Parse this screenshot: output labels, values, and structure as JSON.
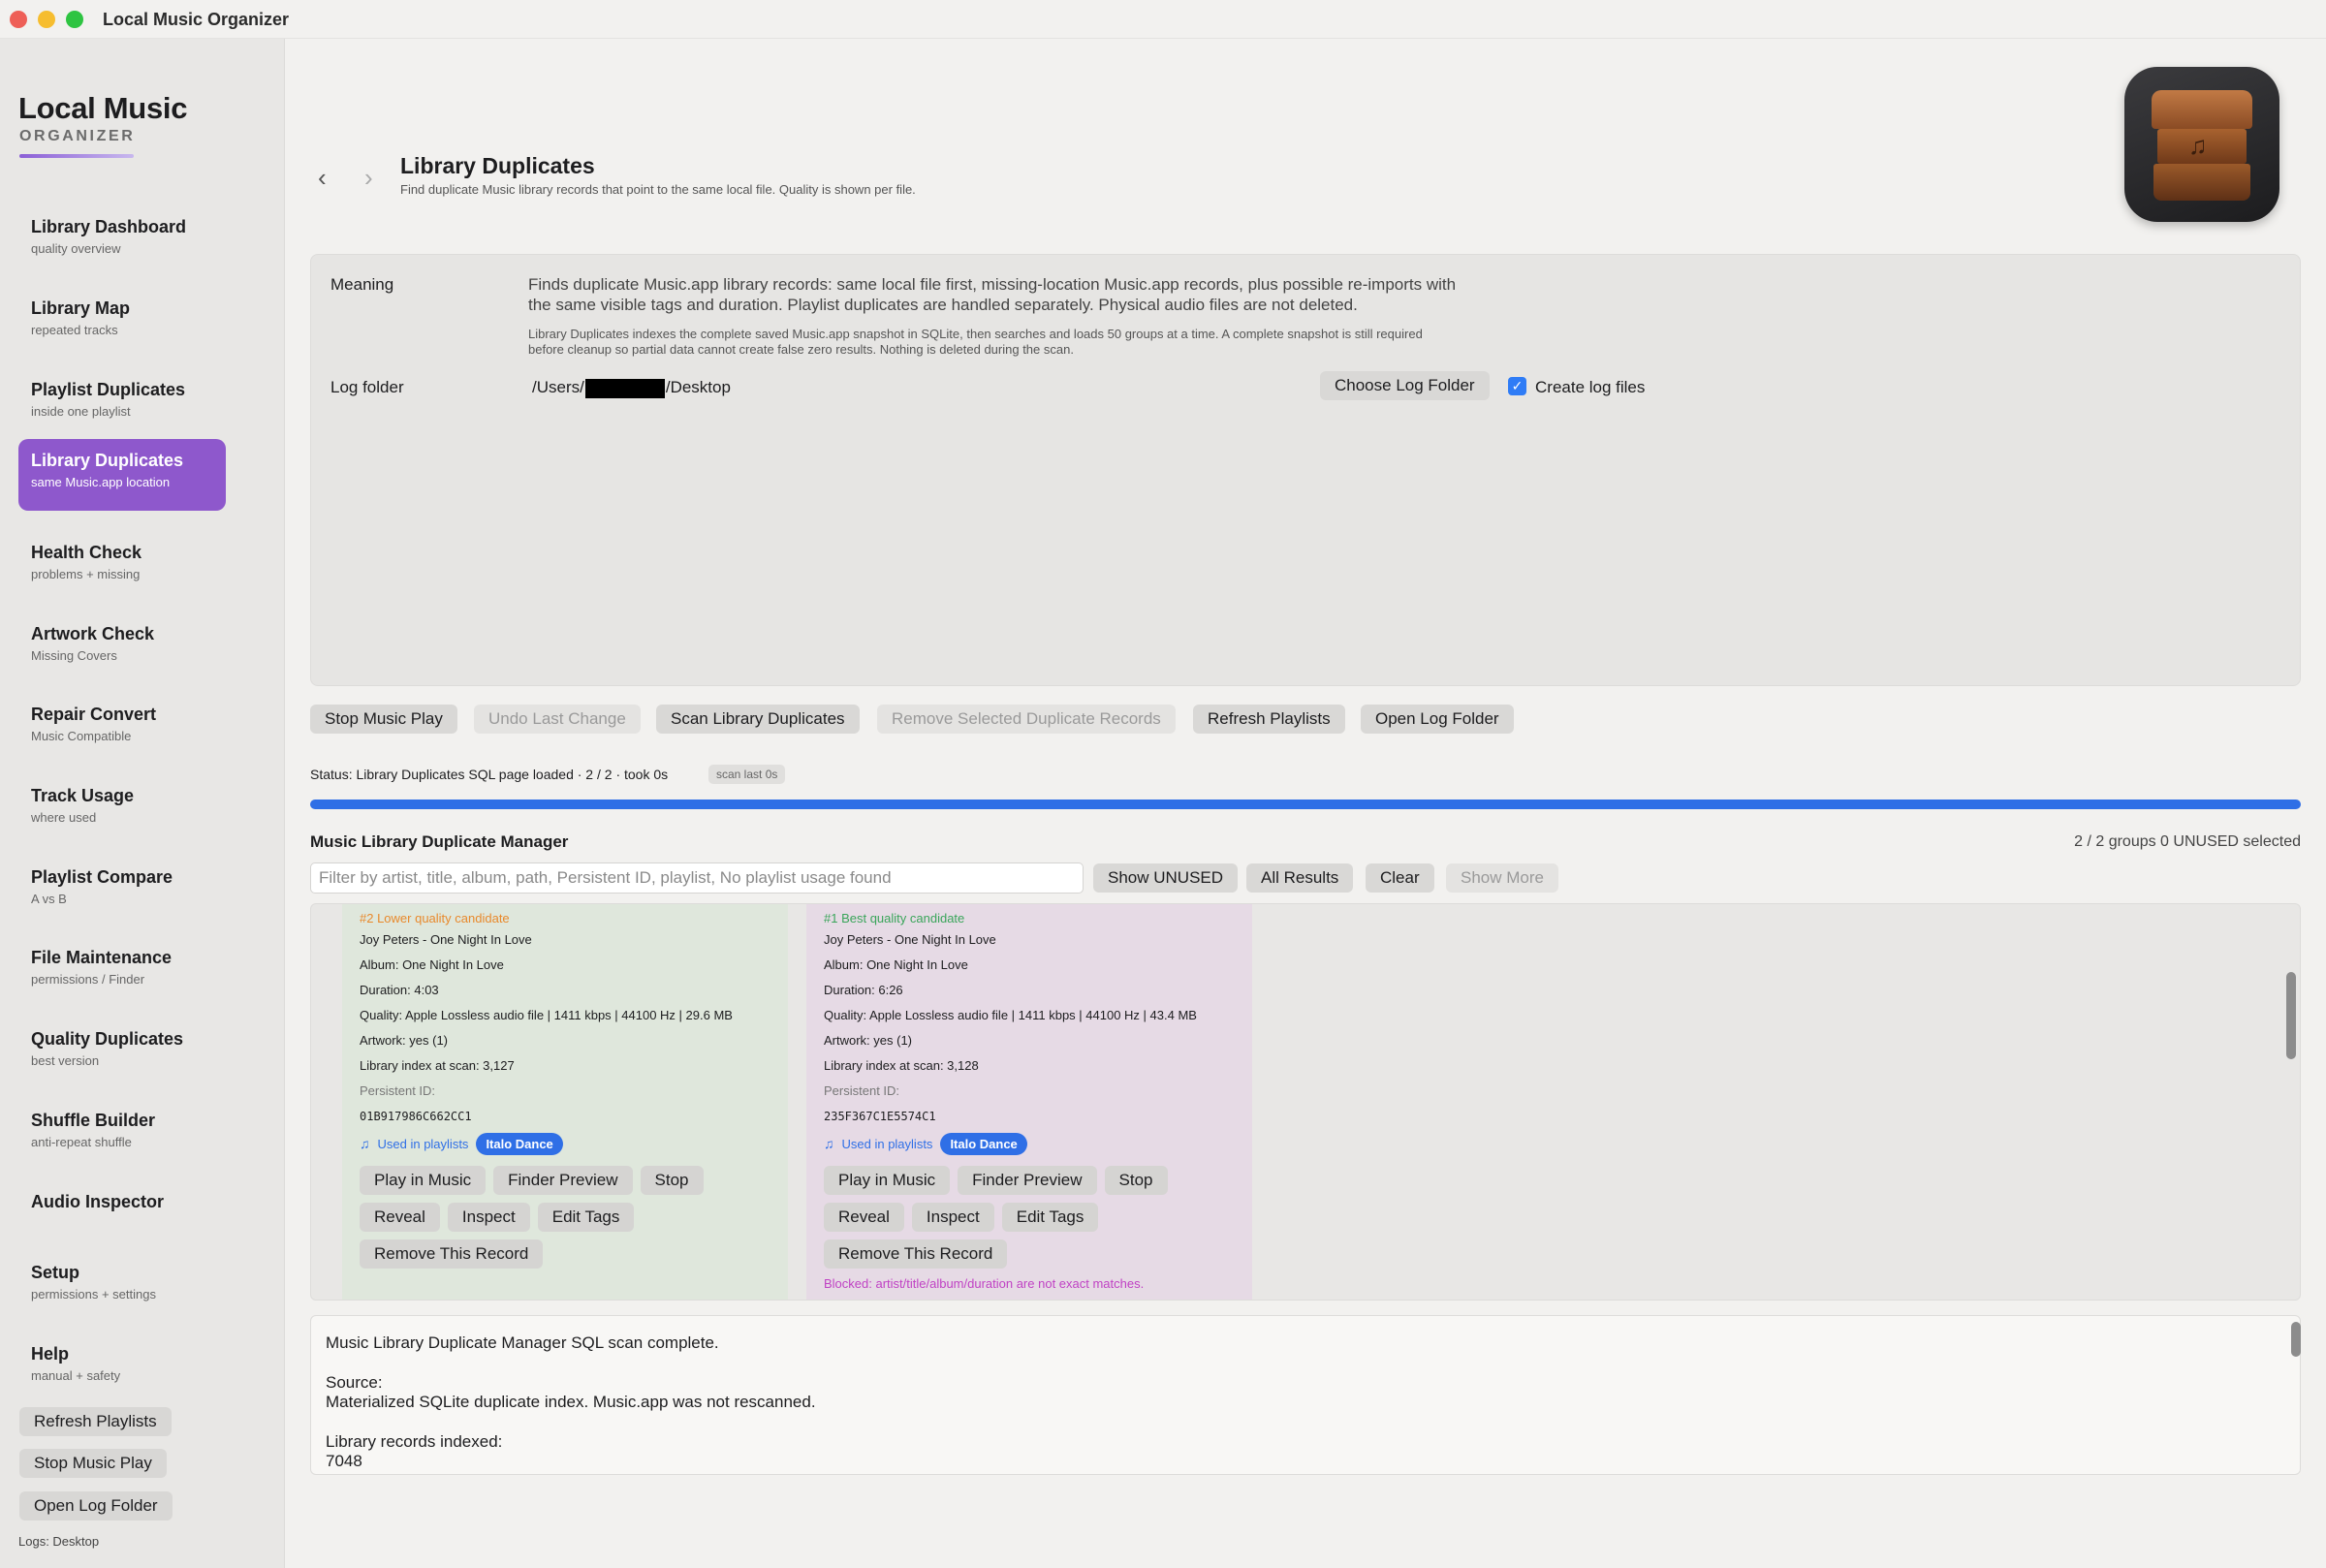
{
  "window": {
    "title": "Local Music Organizer"
  },
  "brand": {
    "name": "Local Music",
    "sub": "ORGANIZER"
  },
  "sidebar": {
    "items": [
      {
        "title": "Library Dashboard",
        "sub": "quality overview"
      },
      {
        "title": "Library Map",
        "sub": "repeated tracks"
      },
      {
        "title": "Playlist Duplicates",
        "sub": "inside one playlist"
      },
      {
        "title": "Library Duplicates",
        "sub": "same Music.app location",
        "active": true
      },
      {
        "title": "Health Check",
        "sub": "problems + missing"
      },
      {
        "title": "Artwork Check",
        "sub": "Missing Covers"
      },
      {
        "title": "Repair Convert",
        "sub": "Music Compatible"
      },
      {
        "title": "Track Usage",
        "sub": "where used"
      },
      {
        "title": "Playlist Compare",
        "sub": "A vs B"
      },
      {
        "title": "File Maintenance",
        "sub": "permissions / Finder"
      },
      {
        "title": "Quality Duplicates",
        "sub": "best version"
      },
      {
        "title": "Shuffle Builder",
        "sub": "anti-repeat shuffle"
      },
      {
        "title": "Audio Inspector",
        "sub": ""
      },
      {
        "title": "Setup",
        "sub": "permissions + settings"
      },
      {
        "title": "Help",
        "sub": "manual + safety"
      }
    ],
    "buttons": [
      "Refresh Playlists",
      "Stop Music Play",
      "Open Log Folder"
    ],
    "logs_label": "Logs: Desktop"
  },
  "header": {
    "back": "‹",
    "forward": "›",
    "title": "Library Duplicates",
    "subtitle": "Find duplicate Music library records that point to the same local file. Quality is shown per file."
  },
  "info": {
    "meaning_label": "Meaning",
    "meaning_text": "Finds duplicate Music.app library records: same local file first, missing-location Music.app records, plus possible re-imports with the same visible tags and duration. Playlist duplicates are handled separately. Physical audio files are not deleted.",
    "meaning_detail": "Library Duplicates indexes the complete saved Music.app snapshot in SQLite, then searches and loads 50 groups at a time. A complete snapshot is still required before cleanup so partial data cannot create false zero results. Nothing is deleted during the scan.",
    "log_label": "Log folder",
    "log_path_prefix": "/Users/",
    "log_path_suffix": "/Desktop",
    "choose_button": "Choose Log Folder",
    "create_logs_label": "Create log files",
    "create_logs_checked": "✓"
  },
  "actions": {
    "stop_music": "Stop Music Play",
    "undo": "Undo Last Change",
    "scan": "Scan Library Duplicates",
    "remove_selected": "Remove Selected Duplicate Records",
    "refresh": "Refresh Playlists",
    "open_log": "Open Log Folder"
  },
  "status": {
    "text": "Status: Library Duplicates SQL page loaded · 2 / 2 · took 0s",
    "badge": "scan last 0s",
    "progress": 1.0
  },
  "manager": {
    "title": "Music Library Duplicate Manager",
    "count": "2 / 2 groups   0 UNUSED selected",
    "filter_placeholder": "Filter by artist, title, album, path, Persistent ID, playlist, No playlist usage found",
    "show_unused": "Show UNUSED",
    "all_results": "All Results",
    "clear": "Clear",
    "show_more": "Show More"
  },
  "cards": [
    {
      "heading": "#2 Lower quality candidate",
      "track": "Joy Peters - One Night In Love",
      "album": "Album: One Night In Love",
      "duration": "Duration: 4:03",
      "quality": "Quality: Apple Lossless audio file | 1411 kbps | 44100 Hz | 29.6 MB",
      "artwork": "Artwork: yes (1)",
      "index": "Library index at scan: 3,127",
      "pid_label": "Persistent ID:",
      "pid": "01B917986C662CC1",
      "used_in": "Used in playlists",
      "playlist": "Italo Dance",
      "buttons": [
        "Play in Music",
        "Finder Preview",
        "Stop",
        "Reveal",
        "Inspect",
        "Edit Tags",
        "Remove This Record"
      ],
      "blocked": ""
    },
    {
      "heading": "#1 Best quality candidate",
      "track": "Joy Peters - One Night In Love",
      "album": "Album: One Night In Love",
      "duration": "Duration: 6:26",
      "quality": "Quality: Apple Lossless audio file | 1411 kbps | 44100 Hz | 43.4 MB",
      "artwork": "Artwork: yes (1)",
      "index": "Library index at scan: 3,128",
      "pid_label": "Persistent ID:",
      "pid": "235F367C1E5574C1",
      "used_in": "Used in playlists",
      "playlist": "Italo Dance",
      "buttons": [
        "Play in Music",
        "Finder Preview",
        "Stop",
        "Reveal",
        "Inspect",
        "Edit Tags",
        "Remove This Record"
      ],
      "blocked": "Blocked: artist/title/album/duration are not exact matches."
    }
  ],
  "log": {
    "line1": "Music Library Duplicate Manager SQL scan complete.",
    "source_label": "Source:",
    "source_text": "Materialized SQLite duplicate index. Music.app was not rescanned.",
    "records_label": "Library records indexed:",
    "records_value": "7048"
  },
  "colors": {
    "accent": "#8e58cc",
    "blue": "#2f6fe6",
    "orange": "#e8892c",
    "green": "#3aa55a",
    "magenta": "#c042c4"
  }
}
